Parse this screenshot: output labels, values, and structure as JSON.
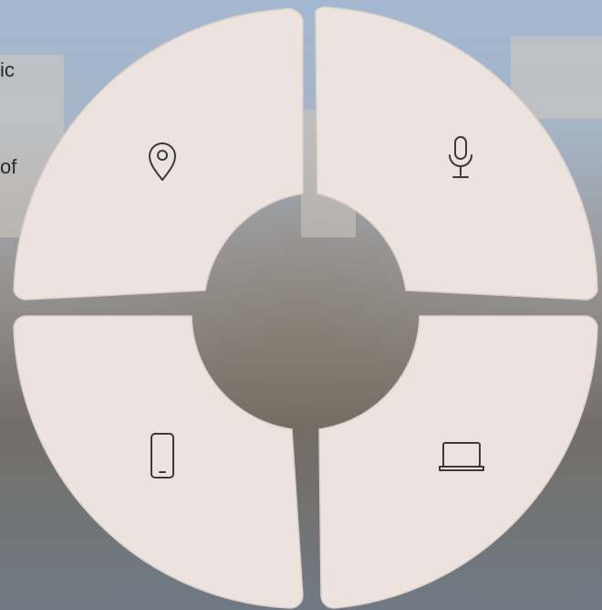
{
  "side_text": {
    "line1": "ic",
    "line2": "of"
  },
  "segments": [
    {
      "id": "location",
      "icon": "map-pin-icon"
    },
    {
      "id": "voice",
      "icon": "microphone-icon"
    },
    {
      "id": "mobile",
      "icon": "smartphone-icon"
    },
    {
      "id": "laptop",
      "icon": "laptop-icon"
    }
  ],
  "colors": {
    "segment_fill": "#ece3df",
    "icon_stroke": "#3a3a3a"
  }
}
